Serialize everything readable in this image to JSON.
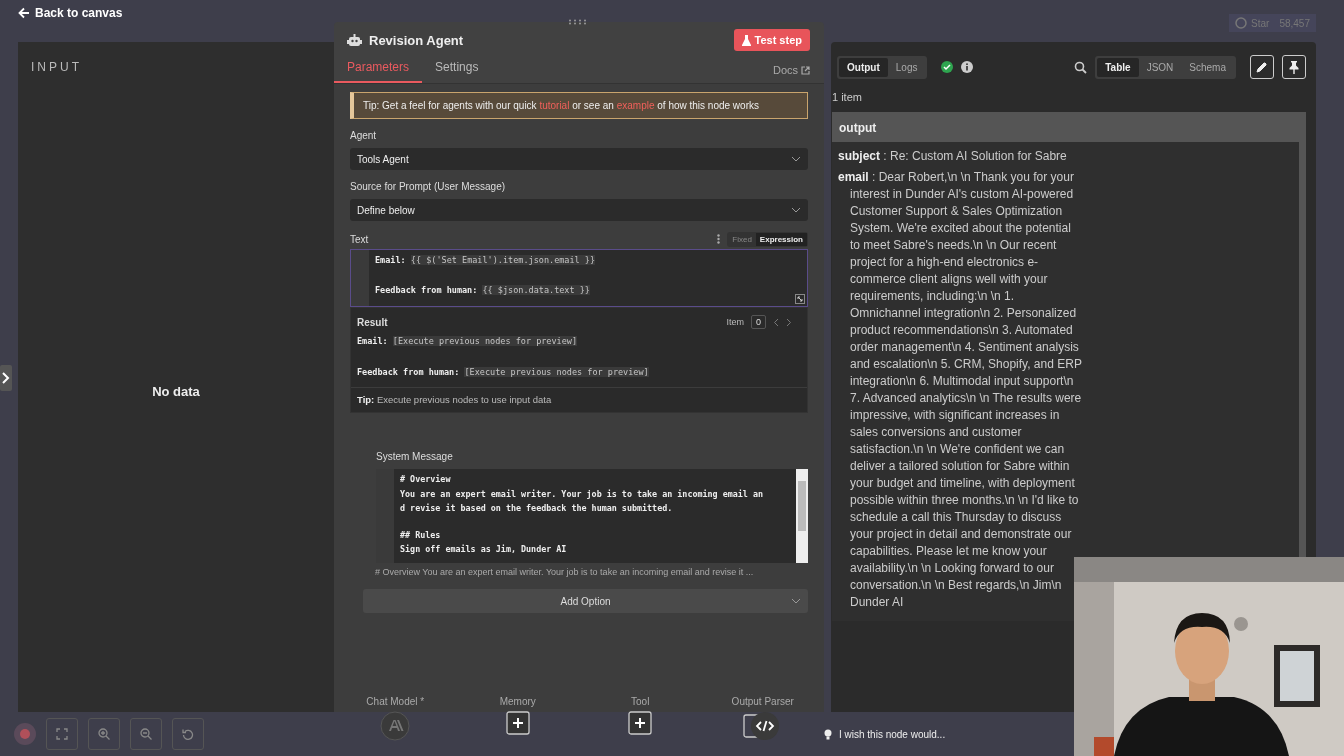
{
  "top_bar": {
    "back_link": "Back to canvas",
    "star_label": "Star",
    "star_count": "58,457"
  },
  "input_panel": {
    "title": "INPUT",
    "empty_text": "No data"
  },
  "node": {
    "title": "Revision Agent",
    "test_button": "Test step",
    "tabs": [
      {
        "label": "Parameters",
        "selected": true
      },
      {
        "label": "Settings",
        "selected": false
      }
    ],
    "docs_link": "Docs",
    "tip": [
      {
        "text": "Tip: Get a feel for agents with our quick ",
        "link": false
      },
      {
        "text": "tutorial",
        "link": true
      },
      {
        "text": " or see an ",
        "link": false
      },
      {
        "text": "example",
        "link": true
      },
      {
        "text": " of how this node works",
        "link": false
      }
    ],
    "fields": [
      {
        "label": "Agent",
        "value": "Tools Agent"
      },
      {
        "label": "Source for Prompt (User Message)",
        "value": "Define below"
      }
    ],
    "text_label": "Text",
    "mode_toggle": [
      {
        "label": "Fixed",
        "selected": false
      },
      {
        "label": "Expression",
        "selected": true
      }
    ],
    "expression_lines": [
      {
        "key": "Email:",
        "expr": "{{ $('Set Email').item.json.email }}"
      },
      {
        "key": "Feedback from human:",
        "expr": "{{ $json.data.text }}"
      }
    ],
    "result": {
      "title": "Result",
      "item_label": "Item",
      "item_index": "0",
      "lines": [
        {
          "key": "Email:",
          "value": "[Execute previous nodes for preview]"
        },
        {
          "key": "Feedback from human:",
          "value": "[Execute previous nodes for preview]"
        }
      ],
      "tip": "**Tip:** Execute previous nodes to use input data"
    },
    "system_message": {
      "label": "System Message",
      "blocks": [
        [
          "# Overview",
          "You are an expert email writer. Your job is to take an incoming email an",
          "d revise it based on the feedback the human submitted."
        ],
        [
          "## Rules",
          "Sign off emails as Jim, Dunder AI"
        ]
      ],
      "preview": "# Overview You are an expert email writer. Your job is to take an incoming email and revise it ..."
    },
    "add_option": "Add Option",
    "connectors": [
      {
        "label": "Chat Model *",
        "kind": "model"
      },
      {
        "label": "Memory",
        "kind": "add"
      },
      {
        "label": "Tool",
        "kind": "add"
      },
      {
        "label": "Output Parser",
        "kind": "parser"
      }
    ]
  },
  "output_panel": {
    "tabs": [
      {
        "label": "Output",
        "selected": true
      },
      {
        "label": "Logs",
        "selected": false
      }
    ],
    "views": [
      {
        "label": "Table",
        "selected": true
      },
      {
        "label": "JSON",
        "selected": false
      },
      {
        "label": "Schema",
        "selected": false
      }
    ],
    "count": "1 item",
    "column": "output",
    "fields": [
      {
        "key": "subject",
        "value": ": Re: Custom AI Solution for Sabre"
      },
      {
        "key": "email",
        "value": ": Dear Robert,\\n \\n Thank you for your interest in Dunder AI's custom AI-powered Customer Support & Sales Optimization System. We're excited about the potential to meet Sabre's needs.\\n \\n Our recent project for a high-end electronics e-commerce client aligns well with your requirements, including:\\n \\n 1. Omnichannel integration\\n 2. Personalized product recommendations\\n 3. Automated order management\\n 4. Sentiment analysis and escalation\\n 5. CRM, Shopify, and ERP integration\\n 6. Multimodal input support\\n 7. Advanced analytics\\n \\n The results were impressive, with significant increases in sales conversions and customer satisfaction.\\n \\n We're confident we can deliver a tailored solution for Sabre within your budget and timeline, with deployment possible within three months.\\n \\n I'd like to schedule a call this Thursday to discuss your project in detail and demonstrate our capabilities. Please let me know your availability.\\n \\n Looking forward to our conversation.\\n \\n Best regards,\\n Jim\\n Dunder AI"
      }
    ],
    "feedback": "I wish this node would..."
  }
}
